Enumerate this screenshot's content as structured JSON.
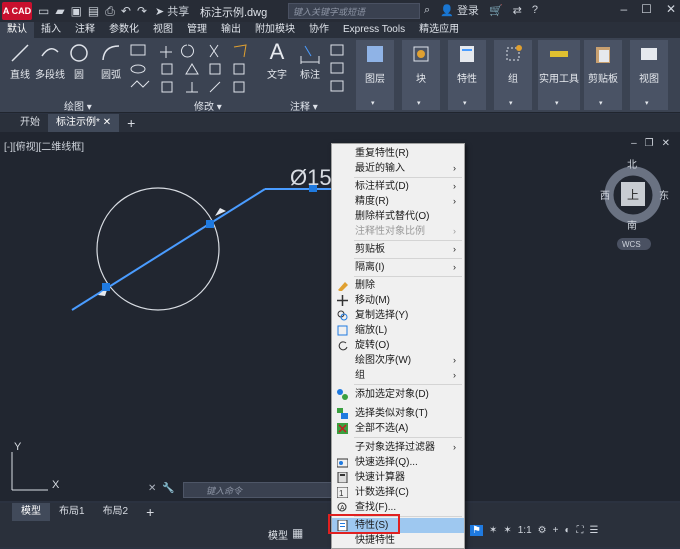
{
  "app": {
    "logo_text": "A CAD",
    "share_label": "共享",
    "document_title": "标注示例.dwg",
    "search_placeholder": "键入关键字或短语",
    "login_label": "登录"
  },
  "ribbon_tabs": [
    "默认",
    "插入",
    "注释",
    "参数化",
    "视图",
    "管理",
    "输出",
    "附加模块",
    "协作",
    "Express Tools",
    "精选应用"
  ],
  "ribbon": {
    "draw_buttons": [
      "直线",
      "多段线",
      "圆",
      "圆弧"
    ],
    "draw_panel": "绘图",
    "modify_panel": "修改",
    "text_label": "文字",
    "dimension_label": "标注",
    "annotation_panel": "注释",
    "groups": [
      "图层",
      "块",
      "特性",
      "组",
      "实用工具",
      "剪贴板",
      "视图"
    ]
  },
  "file_tabs": {
    "start": "开始",
    "current": "标注示例*"
  },
  "viewport": {
    "label": "[-][俯视][二维线框]",
    "dimension_text": "Ø15",
    "ucs_y": "Y",
    "ucs_x": "X"
  },
  "viewcube": {
    "north": "北",
    "south": "南",
    "east": "东",
    "west": "西",
    "top": "上",
    "wcs": "WCS"
  },
  "command_placeholder": "键入命令",
  "layout_tabs": [
    "模型",
    "布局1",
    "布局2"
  ],
  "status": {
    "model": "模型",
    "scale": "1:1"
  },
  "context_menu": {
    "items": [
      {
        "label": "重复特性(R)",
        "icon": "",
        "sub": false,
        "disabled": false
      },
      {
        "label": "最近的输入",
        "icon": "",
        "sub": true,
        "disabled": false
      },
      {
        "label": "标注样式(D)",
        "icon": "",
        "sub": true,
        "disabled": false
      },
      {
        "label": "精度(R)",
        "icon": "",
        "sub": true,
        "disabled": false
      },
      {
        "label": "删除样式替代(O)",
        "icon": "",
        "sub": false,
        "disabled": false
      },
      {
        "label": "注释性对象比例",
        "icon": "",
        "sub": true,
        "disabled": true
      },
      {
        "label": "剪贴板",
        "icon": "",
        "sub": true,
        "disabled": false
      },
      {
        "label": "隔离(I)",
        "icon": "",
        "sub": true,
        "disabled": false
      },
      {
        "label": "删除",
        "icon": "eraser-icon",
        "sub": false,
        "disabled": false
      },
      {
        "label": "移动(M)",
        "icon": "move-icon",
        "sub": false,
        "disabled": false
      },
      {
        "label": "复制选择(Y)",
        "icon": "copy-icon",
        "sub": false,
        "disabled": false
      },
      {
        "label": "缩放(L)",
        "icon": "scale-icon",
        "sub": false,
        "disabled": false
      },
      {
        "label": "旋转(O)",
        "icon": "rotate-icon",
        "sub": false,
        "disabled": false
      },
      {
        "label": "绘图次序(W)",
        "icon": "",
        "sub": true,
        "disabled": false
      },
      {
        "label": "组",
        "icon": "",
        "sub": true,
        "disabled": false
      },
      {
        "label": "添加选定对象(D)",
        "icon": "add-selected-icon",
        "sub": false,
        "disabled": false
      },
      {
        "label": "选择类似对象(T)",
        "icon": "select-similar-icon",
        "sub": false,
        "disabled": false
      },
      {
        "label": "全部不选(A)",
        "icon": "deselect-icon",
        "sub": false,
        "disabled": false
      },
      {
        "label": "子对象选择过滤器",
        "icon": "",
        "sub": true,
        "disabled": false
      },
      {
        "label": "快速选择(Q)...",
        "icon": "quick-select-icon",
        "sub": false,
        "disabled": false
      },
      {
        "label": "快速计算器",
        "icon": "calculator-icon",
        "sub": false,
        "disabled": false
      },
      {
        "label": "计数选择(C)",
        "icon": "count-icon",
        "sub": false,
        "disabled": false
      },
      {
        "label": "查找(F)...",
        "icon": "find-icon",
        "sub": false,
        "disabled": false
      },
      {
        "label": "特性(S)",
        "icon": "properties-icon",
        "sub": false,
        "disabled": false,
        "selected": true
      },
      {
        "label": "快捷特性",
        "icon": "",
        "sub": false,
        "disabled": false
      }
    ]
  },
  "colors": {
    "accent": "#1f7ae0",
    "selection": "#4a9cff",
    "highlight_box": "#e02020"
  }
}
